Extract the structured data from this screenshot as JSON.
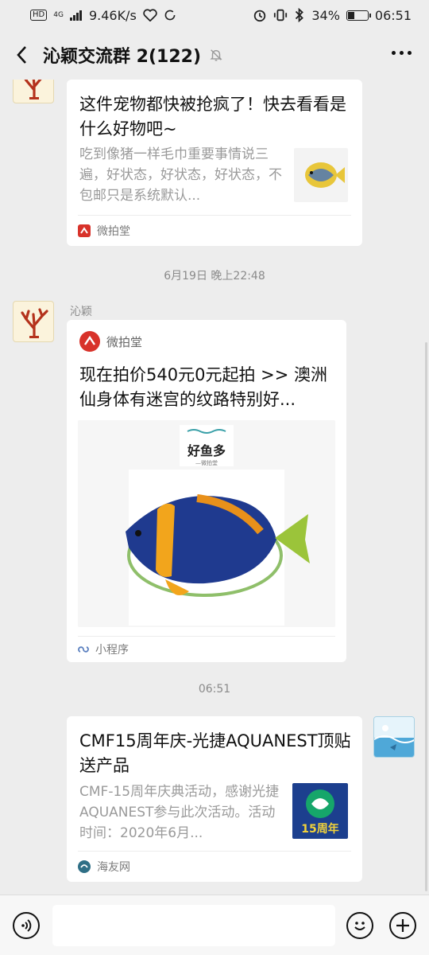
{
  "status": {
    "hd": "HD",
    "net": "4G",
    "speed": "9.46K/s",
    "battery": "34%",
    "battery_level": 0.34,
    "time": "06:51"
  },
  "nav": {
    "title": "沁颖交流群 2(122)"
  },
  "messages": {
    "m1": {
      "title": "这件宠物都快被抢疯了！快去看看是什么好物吧~",
      "desc": "吃到像猪一样毛巾重要事情说三遍，好状态，好状态，好状态，不包邮只是系统默认...",
      "source": "微拍堂"
    },
    "ts1": "6月19日 晚上22:48",
    "m2": {
      "sender": "沁颖",
      "brand": "微拍堂",
      "title": "现在拍价540元0元起拍 >> 澳洲仙身体有迷宫的纹路特别好...",
      "img_text": "好鱼多",
      "img_subtext": "—微拍堂",
      "footer": "小程序"
    },
    "ts2": "06:51",
    "m3": {
      "title": "CMF15周年庆-光捷AQUANEST顶贴送产品",
      "desc": "CMF-15周年庆典活动，感谢光捷AQUANEST参与此次活动。活动时间：2020年6月...",
      "thumb_text": "15周年",
      "source": "海友网"
    }
  },
  "colors": {
    "bg": "#ededed",
    "accent_red": "#d8322a",
    "card": "#ffffff"
  },
  "icons": [
    "back-arrow-icon",
    "mute-bell-icon",
    "more-icon",
    "voice-icon",
    "emoji-icon",
    "plus-icon"
  ]
}
